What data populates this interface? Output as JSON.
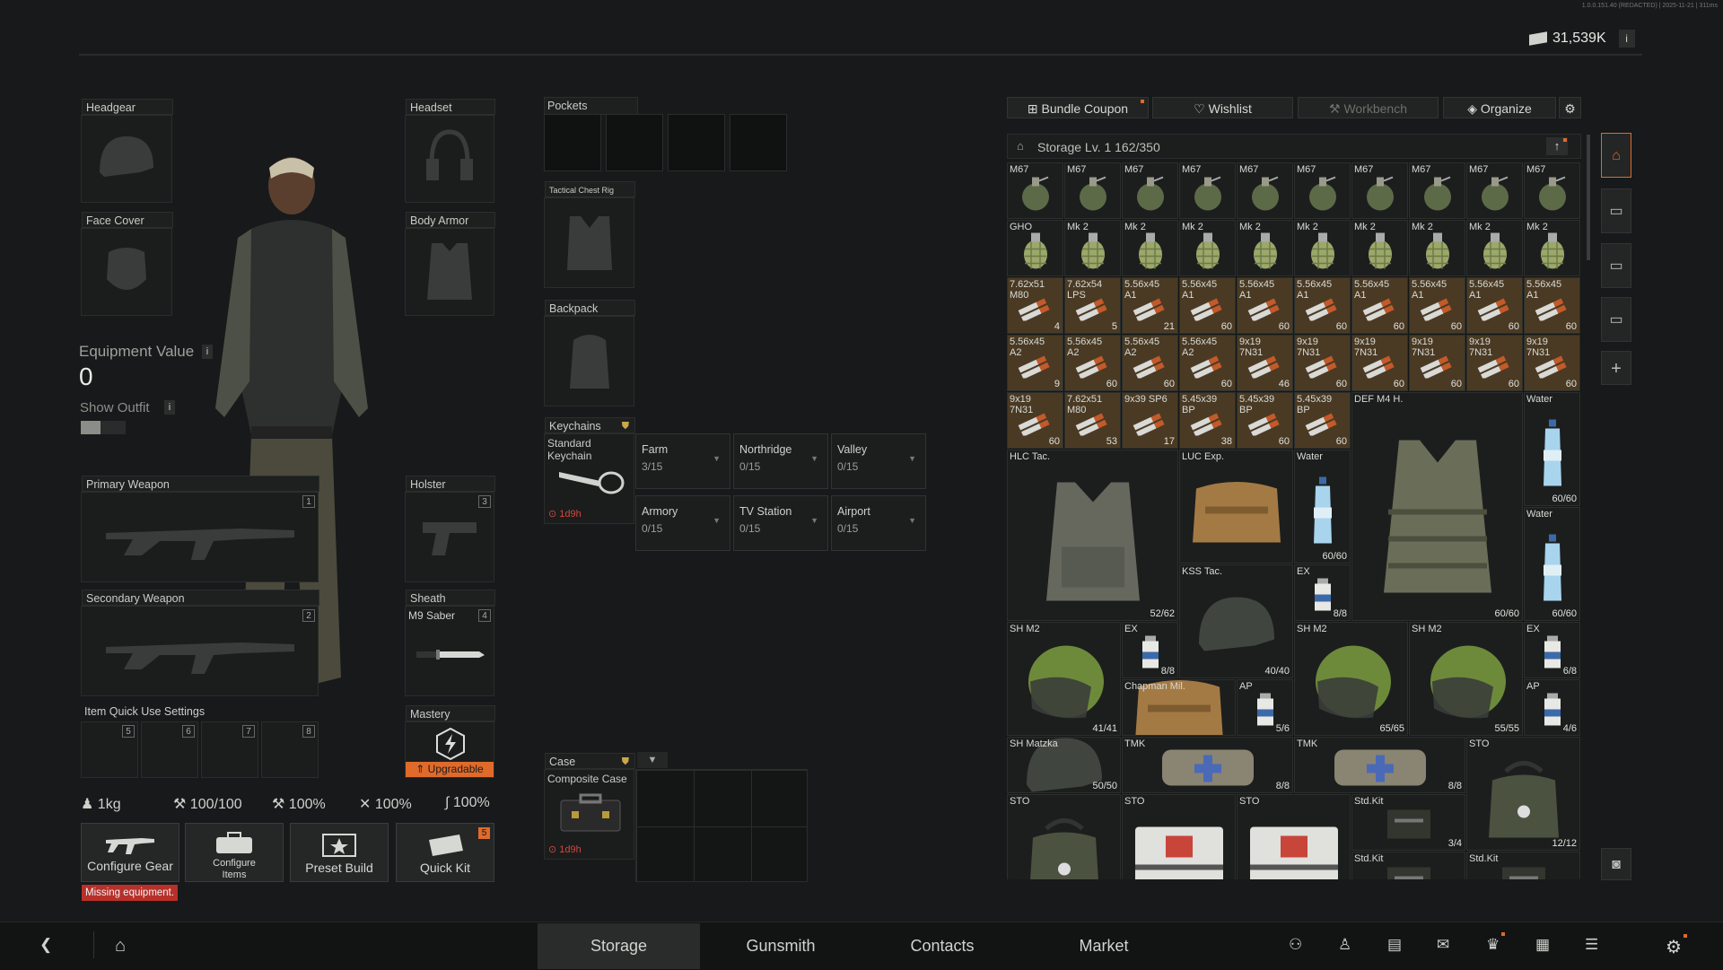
{
  "header": {
    "build_info": "1.0.0.151.40 (REDACTED) | 2025-11-21 | 311ms",
    "currency": "31,539K"
  },
  "equipment": {
    "headgear": "Headgear",
    "headset": "Headset",
    "face_cover": "Face Cover",
    "body_armor": "Body Armor",
    "equipment_value_label": "Equipment Value",
    "equipment_value": "0",
    "show_outfit": "Show Outfit",
    "primary_weapon": "Primary Weapon",
    "primary_num": "1",
    "holster": "Holster",
    "holster_num": "3",
    "secondary_weapon": "Secondary Weapon",
    "secondary_num": "2",
    "sheath": "Sheath",
    "sheath_num": "4",
    "sheath_item": "M9 Saber",
    "quick_use": "Item Quick Use Settings",
    "quick_slots": [
      "5",
      "6",
      "7",
      "8"
    ],
    "mastery": "Mastery",
    "upgradable": "Upgradable"
  },
  "stats": {
    "weight": "1kg",
    "durability": "100/100",
    "stat2": "100%",
    "stat3": "100%",
    "stat4": "100%"
  },
  "actions": {
    "configure_gear": "Configure Gear",
    "missing": "Missing equipment.",
    "configure_items": "Configure Items",
    "preset_build": "Preset Build",
    "quick_kit": "Quick Kit",
    "quick_kit_badge": "5"
  },
  "containers": {
    "pockets": "Pockets",
    "rig": "Tactical Chest Rig",
    "backpack": "Backpack",
    "keychains": "Keychains",
    "keychain_item": "Standard Keychain",
    "keychain_timer": "1d9h",
    "keychain_slots": [
      {
        "name": "Farm",
        "count": "3/15"
      },
      {
        "name": "Northridge",
        "count": "0/15"
      },
      {
        "name": "Valley",
        "count": "0/15"
      },
      {
        "name": "Armory",
        "count": "0/15"
      },
      {
        "name": "TV Station",
        "count": "0/15"
      },
      {
        "name": "Airport",
        "count": "0/15"
      }
    ],
    "case": "Case",
    "case_item": "Composite Case",
    "case_timer": "1d9h"
  },
  "storage_tabs": {
    "bundle": "Bundle Coupon",
    "wishlist": "Wishlist",
    "workbench": "Workbench",
    "organize": "Organize"
  },
  "storage": {
    "title": "Storage Lv. 1",
    "capacity": "162/350"
  },
  "items": [
    {
      "n": "M67",
      "c": "",
      "t": "grenade",
      "x": 0,
      "y": 0
    },
    {
      "n": "M67",
      "c": "",
      "t": "grenade",
      "x": 1,
      "y": 0
    },
    {
      "n": "M67",
      "c": "",
      "t": "grenade",
      "x": 2,
      "y": 0
    },
    {
      "n": "M67",
      "c": "",
      "t": "grenade",
      "x": 3,
      "y": 0
    },
    {
      "n": "M67",
      "c": "",
      "t": "grenade",
      "x": 4,
      "y": 0
    },
    {
      "n": "M67",
      "c": "",
      "t": "grenade",
      "x": 5,
      "y": 0
    },
    {
      "n": "M67",
      "c": "",
      "t": "grenade",
      "x": 6,
      "y": 0
    },
    {
      "n": "M67",
      "c": "",
      "t": "grenade",
      "x": 7,
      "y": 0
    },
    {
      "n": "M67",
      "c": "",
      "t": "grenade",
      "x": 8,
      "y": 0
    },
    {
      "n": "M67",
      "c": "",
      "t": "grenade",
      "x": 9,
      "y": 0
    },
    {
      "n": "GHO",
      "c": "",
      "t": "frag",
      "x": 0,
      "y": 1
    },
    {
      "n": "Mk 2",
      "c": "",
      "t": "frag",
      "x": 1,
      "y": 1
    },
    {
      "n": "Mk 2",
      "c": "",
      "t": "frag",
      "x": 2,
      "y": 1
    },
    {
      "n": "Mk 2",
      "c": "",
      "t": "frag",
      "x": 3,
      "y": 1
    },
    {
      "n": "Mk 2",
      "c": "",
      "t": "frag",
      "x": 4,
      "y": 1
    },
    {
      "n": "Mk 2",
      "c": "",
      "t": "frag",
      "x": 5,
      "y": 1
    },
    {
      "n": "Mk 2",
      "c": "",
      "t": "frag",
      "x": 6,
      "y": 1
    },
    {
      "n": "Mk 2",
      "c": "",
      "t": "frag",
      "x": 7,
      "y": 1
    },
    {
      "n": "Mk 2",
      "c": "",
      "t": "frag",
      "x": 8,
      "y": 1
    },
    {
      "n": "Mk 2",
      "c": "",
      "t": "frag",
      "x": 9,
      "y": 1
    },
    {
      "n": "7.62x51 M80",
      "c": "4",
      "t": "ammo",
      "x": 0,
      "y": 2
    },
    {
      "n": "7.62x54 LPS",
      "c": "5",
      "t": "ammo",
      "x": 1,
      "y": 2
    },
    {
      "n": "5.56x45 A1",
      "c": "21",
      "t": "ammo",
      "x": 2,
      "y": 2
    },
    {
      "n": "5.56x45 A1",
      "c": "60",
      "t": "ammo",
      "x": 3,
      "y": 2
    },
    {
      "n": "5.56x45 A1",
      "c": "60",
      "t": "ammo",
      "x": 4,
      "y": 2
    },
    {
      "n": "5.56x45 A1",
      "c": "60",
      "t": "ammo",
      "x": 5,
      "y": 2
    },
    {
      "n": "5.56x45 A1",
      "c": "60",
      "t": "ammo",
      "x": 6,
      "y": 2
    },
    {
      "n": "5.56x45 A1",
      "c": "60",
      "t": "ammo",
      "x": 7,
      "y": 2
    },
    {
      "n": "5.56x45 A1",
      "c": "60",
      "t": "ammo",
      "x": 8,
      "y": 2
    },
    {
      "n": "5.56x45 A1",
      "c": "60",
      "t": "ammo",
      "x": 9,
      "y": 2
    },
    {
      "n": "5.56x45 A2",
      "c": "9",
      "t": "ammo",
      "x": 0,
      "y": 3
    },
    {
      "n": "5.56x45 A2",
      "c": "60",
      "t": "ammo",
      "x": 1,
      "y": 3
    },
    {
      "n": "5.56x45 A2",
      "c": "60",
      "t": "ammo",
      "x": 2,
      "y": 3
    },
    {
      "n": "5.56x45 A2",
      "c": "60",
      "t": "ammo",
      "x": 3,
      "y": 3
    },
    {
      "n": "9x19 7N31",
      "c": "46",
      "t": "ammo",
      "x": 4,
      "y": 3
    },
    {
      "n": "9x19 7N31",
      "c": "60",
      "t": "ammo",
      "x": 5,
      "y": 3
    },
    {
      "n": "9x19 7N31",
      "c": "60",
      "t": "ammo",
      "x": 6,
      "y": 3
    },
    {
      "n": "9x19 7N31",
      "c": "60",
      "t": "ammo",
      "x": 7,
      "y": 3
    },
    {
      "n": "9x19 7N31",
      "c": "60",
      "t": "ammo",
      "x": 8,
      "y": 3
    },
    {
      "n": "9x19 7N31",
      "c": "60",
      "t": "ammo",
      "x": 9,
      "y": 3
    },
    {
      "n": "9x19 7N31",
      "c": "60",
      "t": "ammo",
      "x": 0,
      "y": 4
    },
    {
      "n": "7.62x51 M80",
      "c": "53",
      "t": "ammo",
      "x": 1,
      "y": 4
    },
    {
      "n": "9x39 SP6",
      "c": "17",
      "t": "ammo",
      "x": 2,
      "y": 4
    },
    {
      "n": "5.45x39 BP",
      "c": "38",
      "t": "ammo",
      "x": 3,
      "y": 4
    },
    {
      "n": "5.45x39 BP",
      "c": "60",
      "t": "ammo",
      "x": 4,
      "y": 4
    },
    {
      "n": "5.45x39 BP",
      "c": "60",
      "t": "ammo",
      "x": 5,
      "y": 4
    },
    {
      "n": "DEF M4 H.",
      "c": "60/60",
      "t": "vest",
      "x": 6,
      "y": 4,
      "w": 3,
      "h": 4
    },
    {
      "n": "Water",
      "c": "60/60",
      "t": "water",
      "x": 9,
      "y": 4,
      "w": 1,
      "h": 2
    },
    {
      "n": "HLC Tac.",
      "c": "52/62",
      "t": "rig",
      "x": 0,
      "y": 5,
      "w": 3,
      "h": 3
    },
    {
      "n": "LUC Exp.",
      "c": "",
      "t": "bag",
      "x": 3,
      "y": 5,
      "w": 2,
      "h": 2
    },
    {
      "n": "Water",
      "c": "60/60",
      "t": "water",
      "x": 5,
      "y": 5,
      "w": 1,
      "h": 2
    },
    {
      "n": "Water",
      "c": "60/60",
      "t": "water",
      "x": 9,
      "y": 6,
      "w": 1,
      "h": 2
    },
    {
      "n": "KSS Tac.",
      "c": "40/40",
      "t": "helmet",
      "x": 3,
      "y": 7,
      "w": 2,
      "h": 2
    },
    {
      "n": "EX",
      "c": "8/8",
      "t": "med",
      "x": 5,
      "y": 7
    },
    {
      "n": "SH M2",
      "c": "41/41",
      "t": "helmetg",
      "x": 0,
      "y": 8,
      "w": 2,
      "h": 2
    },
    {
      "n": "EX",
      "c": "8/8",
      "t": "med",
      "x": 2,
      "y": 8
    },
    {
      "n": "SH M2",
      "c": "65/65",
      "t": "helmetg",
      "x": 5,
      "y": 8,
      "w": 2,
      "h": 2
    },
    {
      "n": "SH M2",
      "c": "55/55",
      "t": "helmetg",
      "x": 7,
      "y": 8,
      "w": 2,
      "h": 2
    },
    {
      "n": "EX",
      "c": "6/8",
      "t": "med",
      "x": 9,
      "y": 8
    },
    {
      "n": "Chapman Mil.",
      "c": "",
      "t": "bag",
      "x": 2,
      "y": 9,
      "w": 2,
      "h": 1
    },
    {
      "n": "AP",
      "c": "5/6",
      "t": "med",
      "x": 4,
      "y": 9
    },
    {
      "n": "AP",
      "c": "4/6",
      "t": "med",
      "x": 9,
      "y": 9
    },
    {
      "n": "SH Matzka",
      "c": "50/50",
      "t": "helmet",
      "x": 0,
      "y": 10,
      "w": 2,
      "h": 1
    },
    {
      "n": "TMK",
      "c": "8/8",
      "t": "medkit",
      "x": 2,
      "y": 10,
      "w": 3,
      "h": 1
    },
    {
      "n": "TMK",
      "c": "8/8",
      "t": "medkit",
      "x": 5,
      "y": 10,
      "w": 3,
      "h": 1
    },
    {
      "n": "STO",
      "c": "12/12",
      "t": "sto",
      "x": 8,
      "y": 10,
      "w": 2,
      "h": 2
    },
    {
      "n": "STO",
      "c": "",
      "t": "sto",
      "x": 0,
      "y": 11,
      "w": 2,
      "h": 2
    },
    {
      "n": "STO",
      "c": "",
      "t": "stobox",
      "x": 2,
      "y": 11,
      "w": 2,
      "h": 2
    },
    {
      "n": "STO",
      "c": "",
      "t": "stobox",
      "x": 4,
      "y": 11,
      "w": 2,
      "h": 2
    },
    {
      "n": "Std.Kit",
      "c": "3/4",
      "t": "kit",
      "x": 6,
      "y": 11,
      "w": 2,
      "h": 1
    },
    {
      "n": "Std.Kit",
      "c": "",
      "t": "kit",
      "x": 6,
      "y": 12,
      "w": 2,
      "h": 1
    },
    {
      "n": "Std.Kit",
      "c": "",
      "t": "kit",
      "x": 8,
      "y": 12,
      "w": 2,
      "h": 1
    }
  ],
  "nav": {
    "storage": "Storage",
    "gunsmith": "Gunsmith",
    "contacts": "Contacts",
    "market": "Market"
  },
  "colors": {
    "accent": "#e06a2a",
    "ammo_bg": "#4a3a24",
    "badge": "#e06a2a",
    "warning": "#b8302a"
  }
}
